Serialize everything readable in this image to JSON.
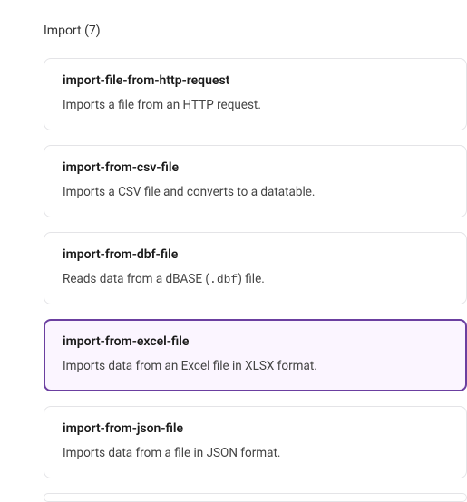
{
  "section": {
    "label": "Import",
    "count": 7
  },
  "items": [
    {
      "title": "import-file-from-http-request",
      "description": "Imports a file from an HTTP request.",
      "selected": false
    },
    {
      "title": "import-from-csv-file",
      "description": "Imports a CSV file and converts to a datatable.",
      "selected": false
    },
    {
      "title": "import-from-dbf-file",
      "description_pre": "Reads data from a dBASE (",
      "description_mono": ".dbf",
      "description_post": ") file.",
      "selected": false
    },
    {
      "title": "import-from-excel-file",
      "description": "Imports data from an Excel file in XLSX format.",
      "selected": true
    },
    {
      "title": "import-from-json-file",
      "description": "Imports data from a file in JSON format.",
      "selected": false
    }
  ]
}
